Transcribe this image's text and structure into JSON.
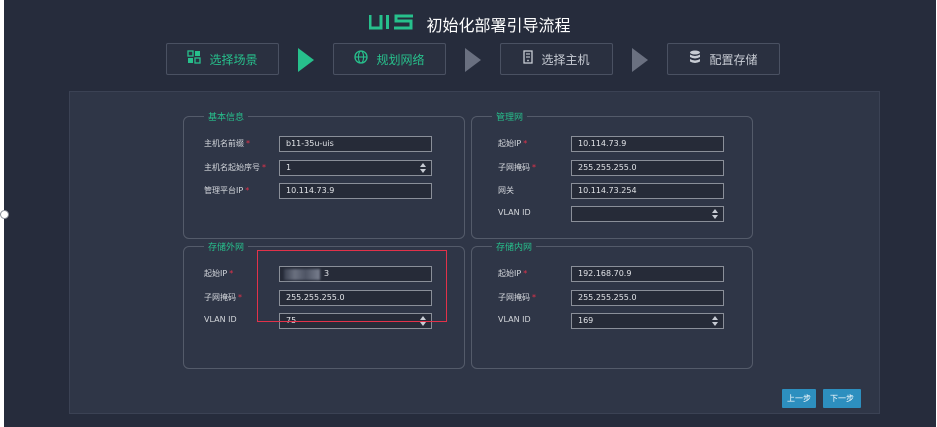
{
  "header": {
    "logo": "UIS",
    "title": "初始化部署引导流程"
  },
  "steps": [
    {
      "label": "选择场景",
      "icon": "scene-icon",
      "state": "done"
    },
    {
      "label": "规划网络",
      "icon": "globe-icon",
      "state": "current"
    },
    {
      "label": "选择主机",
      "icon": "server-icon",
      "state": "pending"
    },
    {
      "label": "配置存储",
      "icon": "database-icon",
      "state": "pending"
    }
  ],
  "basic": {
    "legend": "基本信息",
    "hostname_prefix": {
      "label": "主机名前缀",
      "value": "b11-35u-uis"
    },
    "hostname_start": {
      "label": "主机名起始序号",
      "value": "1"
    },
    "mgmt_ip": {
      "label": "管理平台IP",
      "value": "10.114.73.9"
    }
  },
  "mgmt": {
    "legend": "管理网",
    "start_ip": {
      "label": "起始IP",
      "value": "10.114.73.9"
    },
    "mask": {
      "label": "子网掩码",
      "value": "255.255.255.0"
    },
    "gateway": {
      "label": "网关",
      "value": "10.114.73.254"
    },
    "vlan": {
      "label": "VLAN ID",
      "value": ""
    }
  },
  "storage_ext": {
    "legend": "存储外网",
    "start_ip": {
      "label": "起始IP",
      "value": "3"
    },
    "mask": {
      "label": "子网掩码",
      "value": "255.255.255.0"
    },
    "vlan": {
      "label": "VLAN ID",
      "value": "75"
    }
  },
  "storage_int": {
    "legend": "存储内网",
    "start_ip": {
      "label": "起始IP",
      "value": "192.168.70.9"
    },
    "mask": {
      "label": "子网掩码",
      "value": "255.255.255.0"
    },
    "vlan": {
      "label": "VLAN ID",
      "value": "169"
    }
  },
  "buttons": {
    "prev": "上一步",
    "next": "下一步"
  },
  "colors": {
    "accent": "#27c08c",
    "button": "#2d8fbf",
    "required": "#e2324a",
    "highlight": "#e2324a"
  }
}
